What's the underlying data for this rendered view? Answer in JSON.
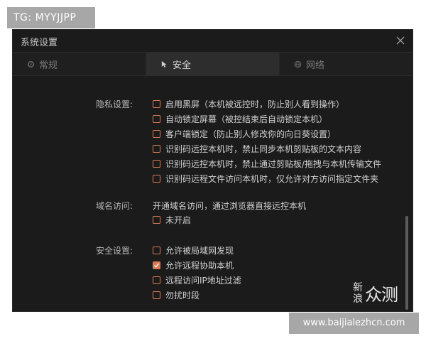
{
  "overlay": {
    "tg_label": "TG: MYYJJPP",
    "site_url": "www.baijialezhcn.com",
    "watermark_small": "新浪",
    "watermark_big": "众测"
  },
  "window": {
    "title": "系统设置",
    "tabs": [
      {
        "label": "常规",
        "icon": "gear-icon",
        "active": false
      },
      {
        "label": "安全",
        "icon": "cursor-icon",
        "active": true
      },
      {
        "label": "网络",
        "icon": "globe-icon",
        "active": false
      }
    ]
  },
  "privacy": {
    "label": "隐私设置:",
    "items": [
      {
        "label": "启用黑屏（本机被远控时，防止别人看到操作）",
        "checked": false
      },
      {
        "label": "自动锁定屏幕（被控结束后自动锁定本机）",
        "checked": false
      },
      {
        "label": "客户端锁定（防止别人修改你的向日葵设置）",
        "checked": false
      },
      {
        "label": "识别码远控本机时，禁止同步本机剪贴板的文本内容",
        "checked": false
      },
      {
        "label": "识别码远控本机时，禁止通过剪贴板/拖拽与本机传输文件",
        "checked": false
      },
      {
        "label": "识别码远程文件访问本机时，仅允许对方访问指定文件夹",
        "checked": false
      }
    ]
  },
  "domain": {
    "label": "域名访问:",
    "description": "开通域名访问，通过浏览器直接远控本机",
    "items": [
      {
        "label": "未开启",
        "checked": false
      }
    ]
  },
  "security": {
    "label": "安全设置:",
    "items": [
      {
        "label": "允许被局域网发现",
        "checked": false
      },
      {
        "label": "允许远程协助本机",
        "checked": true
      },
      {
        "label": "远程访问IP地址过滤",
        "checked": false
      },
      {
        "label": "勿扰时段",
        "checked": false
      }
    ]
  },
  "colors": {
    "checkbox_accent": "#d67b55",
    "window_bg": "#1b1b1b",
    "active_tab_bg": "#2d2d2d"
  }
}
